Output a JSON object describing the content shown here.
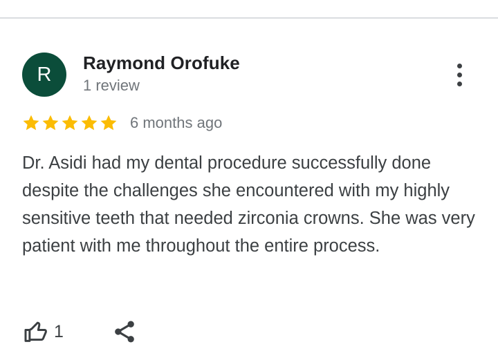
{
  "reviewer": {
    "initial": "R",
    "name": "Raymond Orofuke",
    "review_count": "1 review",
    "avatar_color": "#0b4d3a"
  },
  "menu": {
    "icon": "more-vert-icon"
  },
  "rating": {
    "stars": 5,
    "max_stars": 5,
    "star_color": "#fbbc04",
    "time_ago": "6 months ago"
  },
  "review": {
    "text": "Dr. Asidi had my dental procedure successfully done despite the challenges she encountered with my highly sensitive teeth that needed zirconia crowns. She was very patient with me throughout the entire process."
  },
  "actions": {
    "like": {
      "icon": "thumbs-up-icon",
      "count": "1"
    },
    "share": {
      "icon": "share-icon"
    }
  }
}
